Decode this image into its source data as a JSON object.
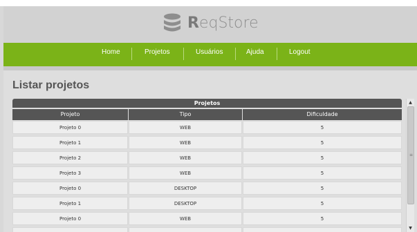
{
  "app": {
    "logo_letter": "R",
    "logo_rest": "eqStore"
  },
  "nav": {
    "items": [
      "Home",
      "Projetos",
      "Usuários",
      "Ajuda",
      "Logout"
    ]
  },
  "page": {
    "title": "Listar projetos"
  },
  "table": {
    "caption": "Projetos",
    "headers": [
      "Projeto",
      "Tipo",
      "Dificuldade"
    ],
    "rows": [
      [
        "Projeto 0",
        "WEB",
        "5"
      ],
      [
        "Projeto 1",
        "WEB",
        "5"
      ],
      [
        "Projeto 2",
        "WEB",
        "5"
      ],
      [
        "Projeto 3",
        "WEB",
        "5"
      ],
      [
        "Projeto 0",
        "DESKTOP",
        "5"
      ],
      [
        "Projeto 1",
        "DESKTOP",
        "5"
      ],
      [
        "Projeto 0",
        "WEB",
        "5"
      ],
      [
        "",
        "",
        ""
      ]
    ]
  },
  "colors": {
    "nav_green": "#7bb318",
    "header_dark": "#555555"
  },
  "icons": {
    "logo": "database-stack-icon",
    "scroll_up": "triangle-up-icon",
    "scroll_down": "triangle-down-icon"
  }
}
